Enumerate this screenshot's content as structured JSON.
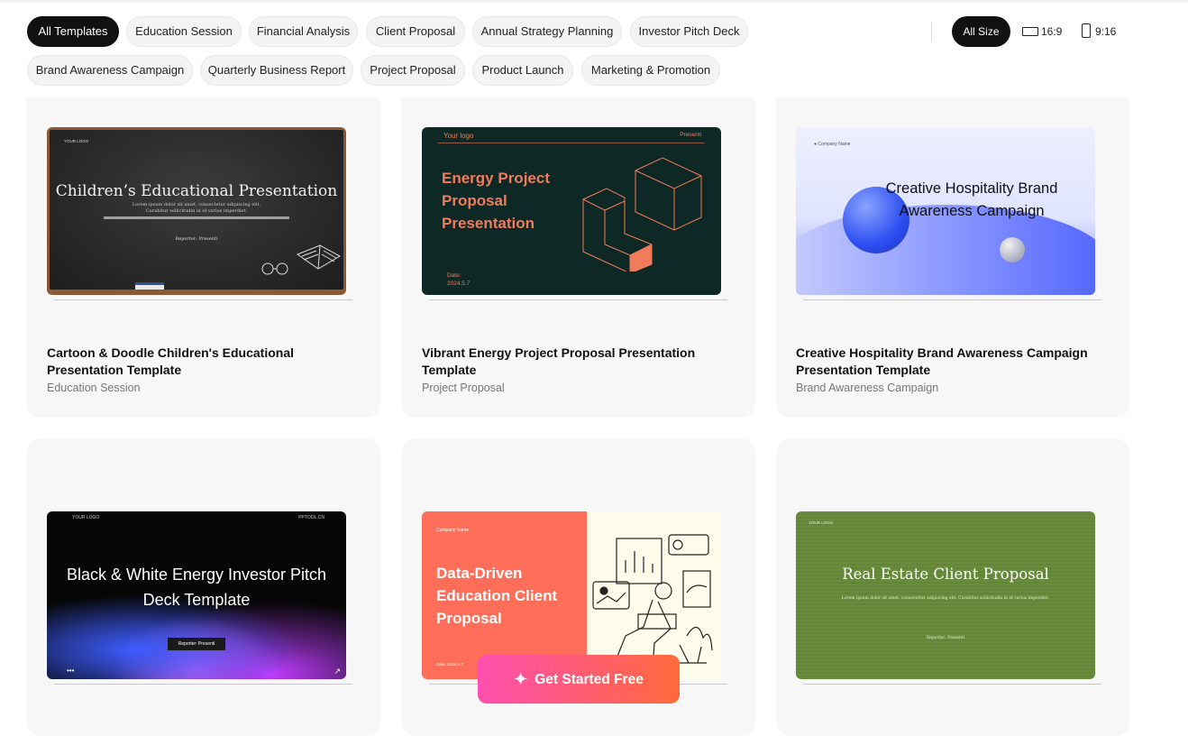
{
  "filters": {
    "categories": [
      {
        "label": "All Templates",
        "active": true
      },
      {
        "label": "Education Session",
        "active": false
      },
      {
        "label": "Financial Analysis",
        "active": false
      },
      {
        "label": "Client Proposal",
        "active": false
      },
      {
        "label": "Annual Strategy Planning",
        "active": false
      },
      {
        "label": "Investor Pitch Deck",
        "active": false
      },
      {
        "label": "Brand Awareness Campaign",
        "active": false
      },
      {
        "label": "Quarterly Business Report",
        "active": false
      },
      {
        "label": "Project Proposal",
        "active": false
      },
      {
        "label": "Product Launch",
        "active": false
      },
      {
        "label": "Marketing & Promotion",
        "active": false
      }
    ],
    "sizes": [
      {
        "label": "All Size",
        "active": true
      },
      {
        "label": "16:9",
        "icon": "landscape-ratio-icon",
        "active": false
      },
      {
        "label": "9:16",
        "icon": "portrait-ratio-icon",
        "active": false
      }
    ]
  },
  "cards": [
    {
      "title": "Cartoon & Doodle Children's Educational Presentation Template",
      "category": "Education Session",
      "thumb": {
        "title": "Children’s Educational Presentation",
        "lorem": "Lorem ipsum dolor sit amet, consectetur adipiscing elit. Curabitur sollicitudin in id varius imperdiet.",
        "reporter": "Reporter: Presenti",
        "logo": "YOUR LOGO"
      }
    },
    {
      "title": "Vibrant Energy Project Proposal Presentation Template",
      "category": "Project Proposal",
      "thumb": {
        "title": "Energy Project Proposal Presentation",
        "logo": "Your logo",
        "presenter": "Presenti",
        "date_label": "Date:",
        "date": "2024.5.7"
      }
    },
    {
      "title": "Creative Hospitality Brand Awareness Campaign Presentation Template",
      "category": "Brand Awareness Campaign",
      "thumb": {
        "title": "Creative Hospitality Brand Awareness Campaign",
        "logo": "Company Name"
      }
    },
    {
      "title": "",
      "category": "",
      "thumb": {
        "title": "Black & White Energy Investor Pitch Deck Template",
        "button": "Reporter: Presenti",
        "logo": "YOUR LOGO",
        "logo2": "PPTOOL.CN"
      }
    },
    {
      "title": "",
      "category": "",
      "thumb": {
        "title": "Data-Driven Education Client Proposal",
        "logo": "Company Name",
        "date": "Date: 2024.5.7"
      }
    },
    {
      "title": "",
      "category": "",
      "thumb": {
        "title": "Real Estate Client Proposal",
        "lorem": "Lorem ipsum dolor sit amet, consectetur adipiscing elit. Curabitur sollicitudin in id varius imperdiet.",
        "reporter": "Reporter: Presenti",
        "logo": "YOUR LOGO"
      }
    }
  ],
  "cta": {
    "label": "Get Started Free",
    "icon": "sparkle-icon"
  },
  "colors": {
    "accent_dark": "#111111",
    "cta_start": "#ff4fb0",
    "cta_end": "#ff6a3a"
  }
}
